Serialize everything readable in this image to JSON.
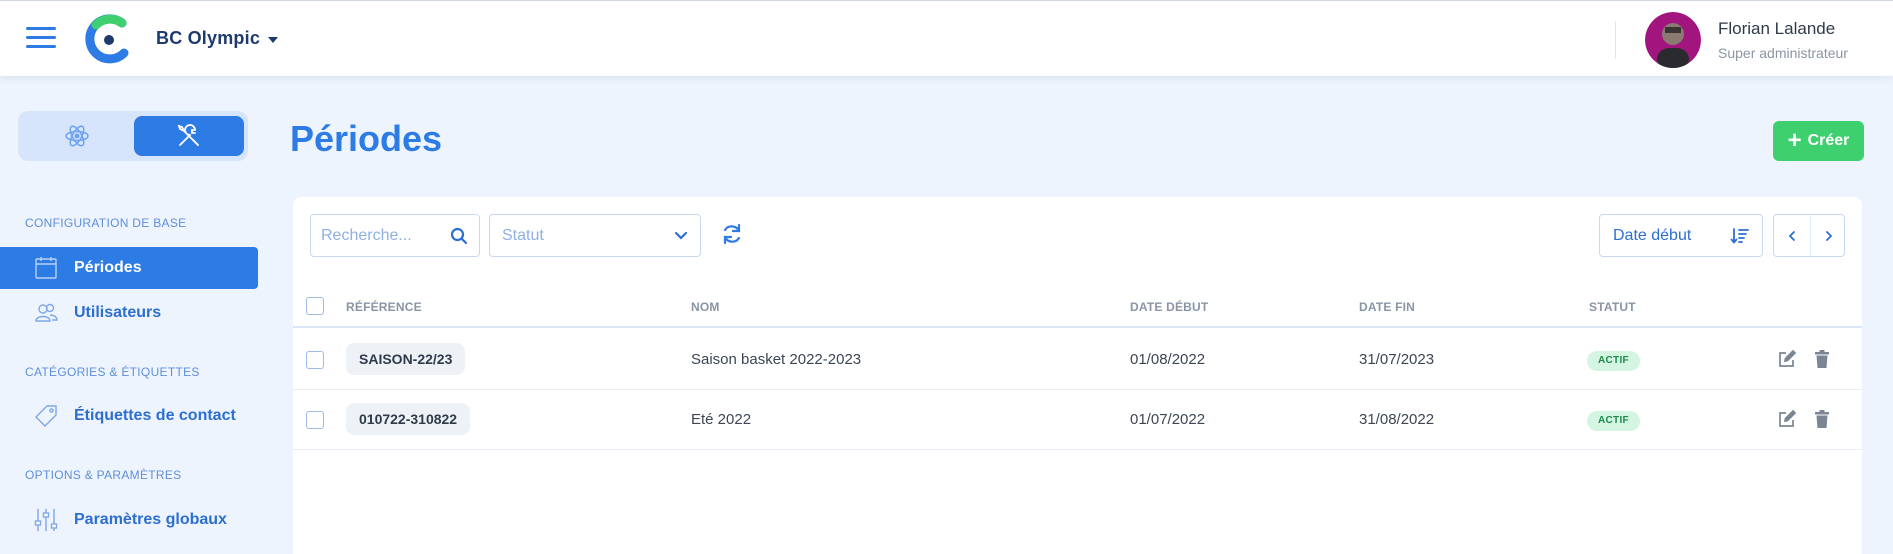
{
  "header": {
    "club_name": "BC Olympic",
    "user": {
      "name": "Florian Lalande",
      "role": "Super administrateur"
    }
  },
  "sidebar": {
    "sections": [
      {
        "title": "CONFIGURATION DE BASE",
        "items": [
          {
            "label": "Périodes",
            "icon": "calendar-icon",
            "active": true
          },
          {
            "label": "Utilisateurs",
            "icon": "users-icon"
          }
        ]
      },
      {
        "title": "CATÉGORIES & ÉTIQUETTES",
        "items": [
          {
            "label": "Étiquettes de contact",
            "icon": "tag-icon"
          }
        ]
      },
      {
        "title": "OPTIONS & PARAMÈTRES",
        "items": [
          {
            "label": "Paramètres globaux",
            "icon": "sliders-icon"
          }
        ]
      }
    ]
  },
  "page": {
    "title": "Périodes",
    "create_label": "Créer"
  },
  "toolbar": {
    "search_placeholder": "Recherche...",
    "status_placeholder": "Statut",
    "sort_label": "Date début"
  },
  "table": {
    "columns": [
      "RÉFÉRENCE",
      "NOM",
      "DATE DÉBUT",
      "DATE FIN",
      "STATUT"
    ],
    "rows": [
      {
        "reference": "SAISON-22/23",
        "name": "Saison basket 2022-2023",
        "start": "01/08/2022",
        "end": "31/07/2023",
        "status": "ACTIF"
      },
      {
        "reference": "010722-310822",
        "name": "Eté 2022",
        "start": "01/07/2022",
        "end": "31/08/2022",
        "status": "ACTIF"
      }
    ]
  },
  "colors": {
    "primary": "#2d7be5",
    "success": "#3ecf6e",
    "badge_bg": "#d4f5e2",
    "badge_text": "#1e8a4c"
  }
}
